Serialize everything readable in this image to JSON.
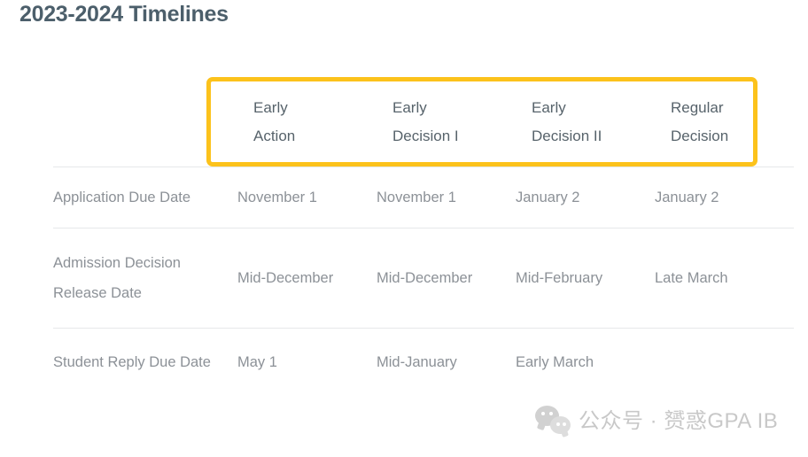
{
  "page": {
    "title": "2023-2024 Timelines"
  },
  "table": {
    "row_header_label": "",
    "columns": [
      {
        "line1": "Early",
        "line2": "Action"
      },
      {
        "line1": "Early",
        "line2": "Decision I"
      },
      {
        "line1": "Early",
        "line2": "Decision II"
      },
      {
        "line1": "Regular",
        "line2": "Decision"
      }
    ],
    "rows": [
      {
        "label": "Application Due Date",
        "values": [
          "November 1",
          "November 1",
          "January 2",
          "January 2"
        ]
      },
      {
        "label": "Admission Decision Release Date",
        "values": [
          "Mid-December",
          "Mid-December",
          "Mid-February",
          "Late March"
        ]
      },
      {
        "label": "Student Reply Due Date",
        "values": [
          "May 1",
          "Mid-January",
          "Early March",
          ""
        ]
      }
    ]
  },
  "highlight": {
    "color": "#fcc21b",
    "target": "column-header-row"
  },
  "watermark": {
    "icon": "wechat-icon",
    "text": "公众号 · 赟惑GPA IB"
  },
  "colors": {
    "title": "#4c5f6b",
    "header_text": "#57636b",
    "body_text": "#8c9197",
    "divider": "#e6e8ea",
    "accent": "#fcc21b",
    "background": "#ffffff"
  }
}
